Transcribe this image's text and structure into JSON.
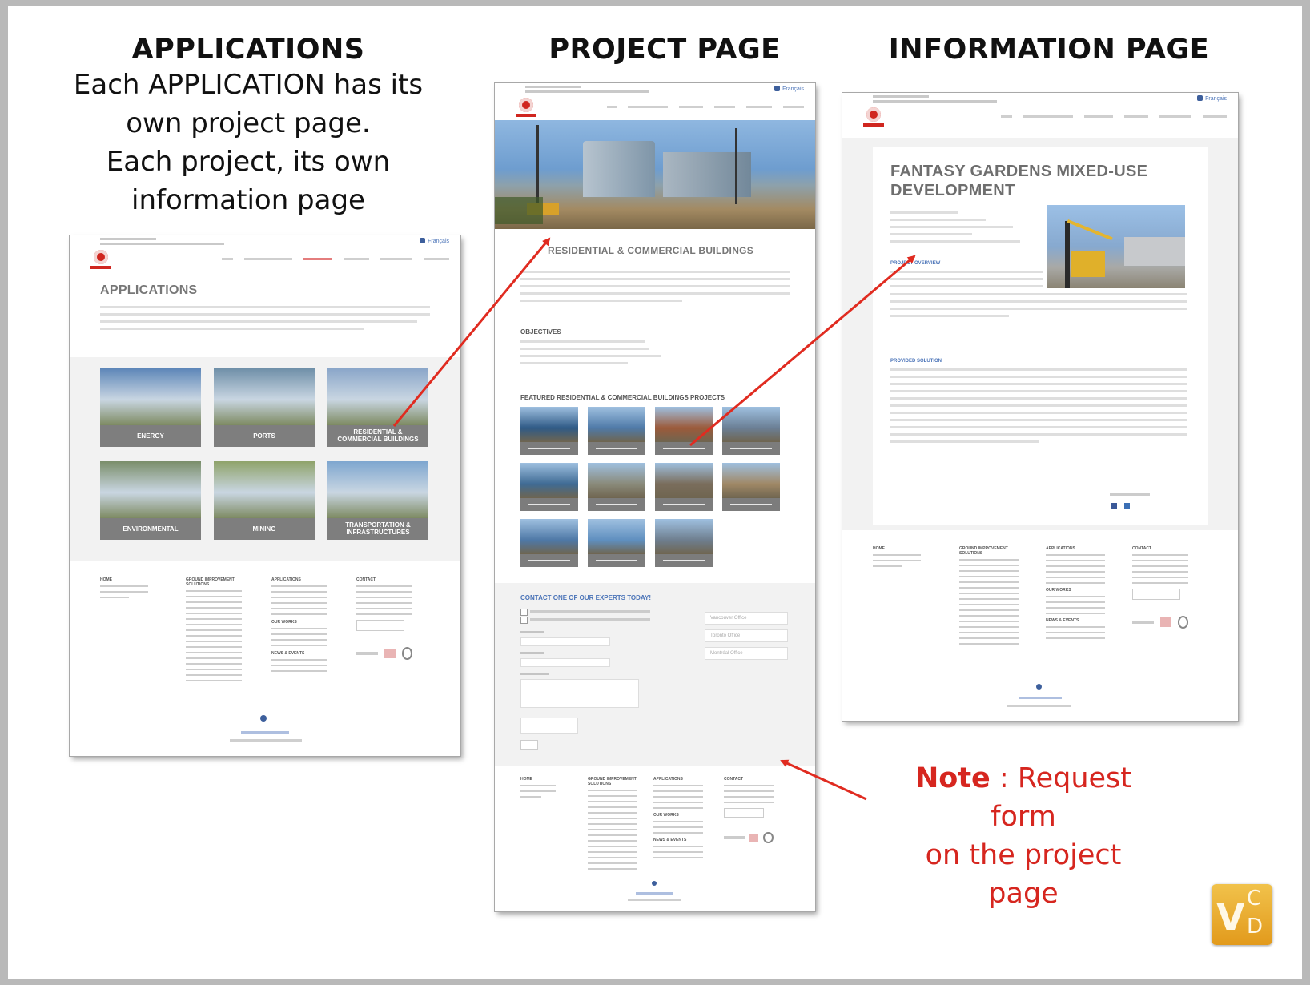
{
  "captions": {
    "applications_title": "APPLICATIONS",
    "applications_body": [
      "Each APPLICATION has its",
      "own project page.",
      "Each project, its own",
      "information page"
    ],
    "project_title": "PROJECT PAGE",
    "information_title": "INFORMATION PAGE"
  },
  "note": {
    "bold": "Note",
    "rest": " : Request form",
    "line2": "on the project page"
  },
  "logo": {
    "v": "V",
    "c": "C",
    "d": "D"
  },
  "common": {
    "lang": "Français"
  },
  "applications_page": {
    "heading": "APPLICATIONS",
    "tiles": [
      {
        "label": "ENERGY",
        "color": "#5d86b8"
      },
      {
        "label": "PORTS",
        "color": "#6f8fa8"
      },
      {
        "label": "RESIDENTIAL & COMMERCIAL BUILDINGS",
        "color": "#8aa6c9"
      },
      {
        "label": "ENVIRONMENTAL",
        "color": "#7a8e6a"
      },
      {
        "label": "MINING",
        "color": "#8fa36a"
      },
      {
        "label": "TRANSPORTATION & INFRASTRUCTURES",
        "color": "#7ea6cf"
      }
    ]
  },
  "project_page": {
    "heading": "RESIDENTIAL & COMMERCIAL BUILDINGS",
    "objectives": "OBJECTIVES",
    "featured": "FEATURED RESIDENTIAL & COMMERCIAL BUILDINGS PROJECTS",
    "contact": "CONTACT ONE OF OUR EXPERTS TODAY!",
    "projects": [
      {
        "color": "#2f5a86"
      },
      {
        "color": "#4f7aa8"
      },
      {
        "color": "#9c5a3a"
      },
      {
        "color": "#6b7f95"
      },
      {
        "color": "#3f6b94"
      },
      {
        "color": "#8a8a7a"
      },
      {
        "color": "#7a6d5c"
      },
      {
        "color": "#a08866"
      },
      {
        "color": "#4e78a6"
      },
      {
        "color": "#5f8fbf"
      },
      {
        "color": "#6e7e8e"
      }
    ],
    "offices": [
      "Vancouver Office",
      "Toronto Office",
      "Montréal Office"
    ]
  },
  "information_page": {
    "heading_line1": "FANTASY GARDENS MIXED-USE",
    "heading_line2": "DEVELOPMENT",
    "overview": "PROJECT OVERVIEW",
    "solution": "PROVIDED SOLUTION"
  },
  "colors": {
    "arrow": "#e02b20",
    "note": "#d6261f"
  }
}
